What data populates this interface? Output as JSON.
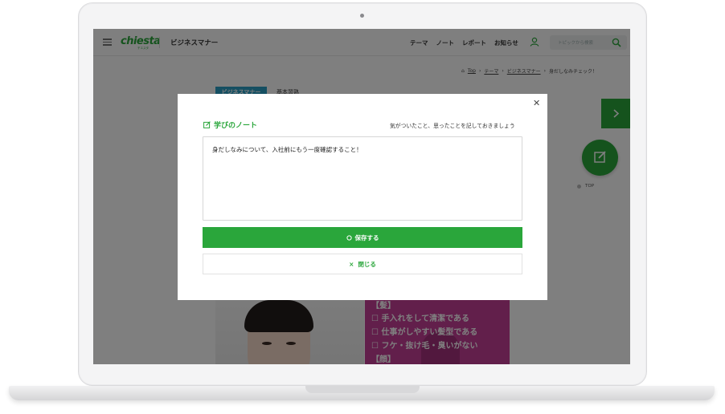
{
  "header": {
    "logo": "chiesta",
    "logo_sub": "チエスタ",
    "title": "ビジネスマナー",
    "nav": [
      "テーマ",
      "ノート",
      "レポート",
      "お知らせ"
    ],
    "search_placeholder": "トピックから検索"
  },
  "breadcrumb": {
    "items": [
      "Top",
      "テーマ",
      "ビジネスマナー"
    ],
    "current": "身だしなみチェック！"
  },
  "page": {
    "tag_primary": "ビジネスマナー",
    "tag_secondary": "基本習熟",
    "top_link": "TOP",
    "pink_lines": [
      "【髪】",
      "☐ 手入れをして清潔である",
      "☐ 仕事がしやすい髪型である",
      "☐ フケ・抜け毛・臭いがない",
      "【顔】"
    ]
  },
  "modal": {
    "title": "学びのノート",
    "hint": "気がついたこと、思ったことを記しておきましょう",
    "note_text": "身だしなみについて、入社前にもう一度確認すること！",
    "save_label": "保存する",
    "close_label": "閉じる"
  },
  "colors": {
    "brand_green": "#2aa63b",
    "tag_blue": "#2a9ec4",
    "pink": "#c43f96"
  }
}
